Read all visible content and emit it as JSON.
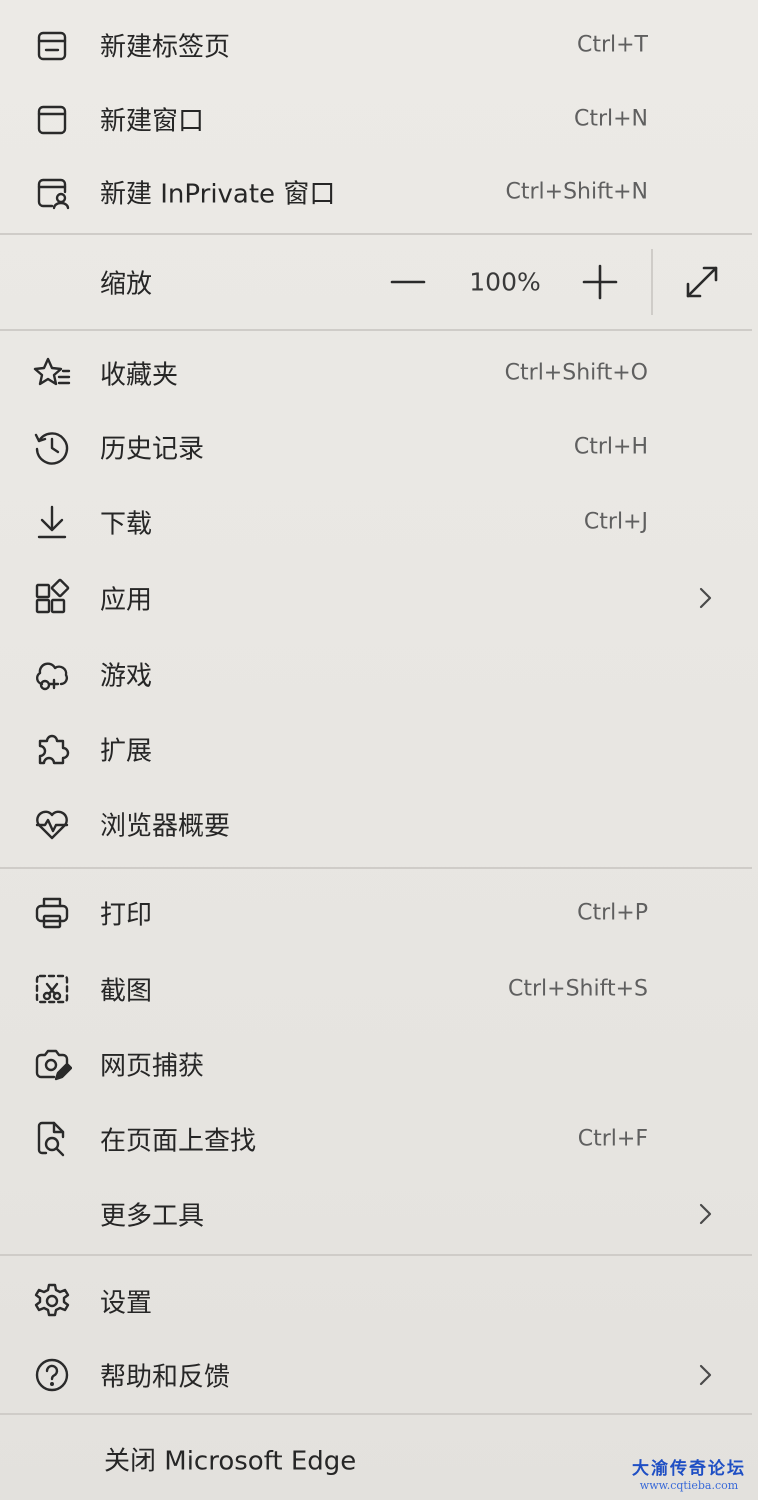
{
  "menu": {
    "new_tab": {
      "label": "新建标签页",
      "shortcut": "Ctrl+T",
      "icon": "new-tab-icon"
    },
    "new_window": {
      "label": "新建窗口",
      "shortcut": "Ctrl+N",
      "icon": "new-window-icon"
    },
    "new_inprivate": {
      "label": "新建 InPrivate 窗口",
      "shortcut": "Ctrl+Shift+N",
      "icon": "inprivate-window-icon"
    },
    "zoom": {
      "label": "缩放",
      "value": "100%",
      "minus_icon": "minus-icon",
      "plus_icon": "plus-icon",
      "fullscreen_icon": "fullscreen-icon"
    },
    "favorites": {
      "label": "收藏夹",
      "shortcut": "Ctrl+Shift+O",
      "icon": "favorites-icon"
    },
    "history": {
      "label": "历史记录",
      "shortcut": "Ctrl+H",
      "icon": "history-icon"
    },
    "downloads": {
      "label": "下载",
      "shortcut": "Ctrl+J",
      "icon": "download-icon"
    },
    "apps": {
      "label": "应用",
      "icon": "apps-icon"
    },
    "games": {
      "label": "游戏",
      "icon": "games-icon"
    },
    "extensions": {
      "label": "扩展",
      "icon": "extensions-icon"
    },
    "browser_essentials": {
      "label": "浏览器概要",
      "icon": "heart-pulse-icon"
    },
    "print": {
      "label": "打印",
      "shortcut": "Ctrl+P",
      "icon": "print-icon"
    },
    "screenshot": {
      "label": "截图",
      "shortcut": "Ctrl+Shift+S",
      "icon": "screenshot-icon"
    },
    "web_capture": {
      "label": "网页捕获",
      "icon": "web-capture-icon"
    },
    "find_on_page": {
      "label": "在页面上查找",
      "shortcut": "Ctrl+F",
      "icon": "find-on-page-icon"
    },
    "more_tools": {
      "label": "更多工具"
    },
    "settings": {
      "label": "设置",
      "icon": "gear-icon"
    },
    "help_feedback": {
      "label": "帮助和反馈",
      "icon": "help-icon"
    },
    "close_edge": {
      "label": "关闭 Microsoft Edge"
    }
  },
  "watermark": {
    "main": "大渝传奇论坛",
    "sub": "www.cqtieba.com"
  },
  "colors": {
    "menu_background": "#eae8e4",
    "divider": "#cfccc8",
    "watermark": "#1f4fc4"
  }
}
